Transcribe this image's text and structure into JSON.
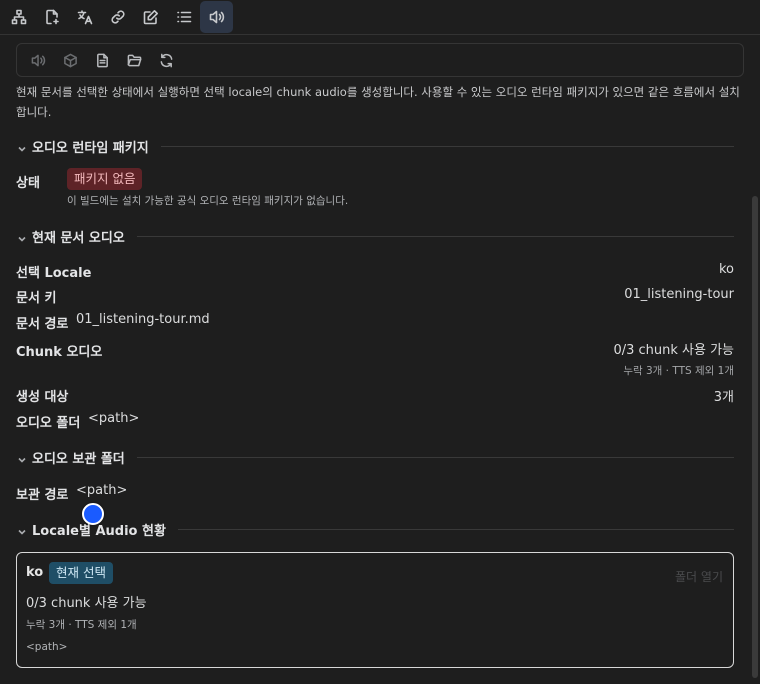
{
  "tabs": [
    {
      "icon": "sitemap-icon"
    },
    {
      "icon": "file-link-icon"
    },
    {
      "icon": "translate-icon"
    },
    {
      "icon": "link-icon"
    },
    {
      "icon": "edit-icon"
    },
    {
      "icon": "list-icon"
    },
    {
      "icon": "speaker-icon",
      "active": true
    }
  ],
  "toolbar": {
    "icons": [
      "speaker-icon",
      "package-icon",
      "document-icon",
      "folder-icon",
      "refresh-icon"
    ]
  },
  "description": "현재 문서를 선택한 상태에서 실행하면 선택 locale의 chunk audio를 생성합니다. 사용할 수 있는 오디오 런타임 패키지가 있으면 같은 흐름에서 설치합니다.",
  "runtime": {
    "heading": "오디오 런타임 패키지",
    "status_label": "상태",
    "status_badge": "패키지 없음",
    "note": "이 빌드에는 설치 가능한 공식 오디오 런타임 패키지가 없습니다."
  },
  "current": {
    "heading": "현재 문서 오디오",
    "locale_label": "선택 Locale",
    "locale_value": "ko",
    "doc_key_label": "문서 키",
    "doc_key_value": "01_listening-tour",
    "doc_path_label": "문서 경로",
    "doc_path_value": "01_listening-tour.md",
    "chunk_label": "Chunk 오디오",
    "chunk_value": "0/3 chunk 사용 가능",
    "chunk_detail": "누락 3개 · TTS 제외 1개",
    "target_label": "생성 대상",
    "target_value": "3개",
    "folder_label": "오디오 폴더",
    "folder_value": "<path>"
  },
  "archive": {
    "heading": "오디오 보관 폴더",
    "path_label": "보관 경로",
    "path_value": "<path>"
  },
  "locales": {
    "heading": "Locale별 Audio 현황",
    "card": {
      "locale": "ko",
      "badge": "현재 선택",
      "open_folder": "폴더 열기",
      "availability": "0/3 chunk 사용 가능",
      "detail": "누락 3개 · TTS 제외 1개",
      "path": "<path>"
    }
  },
  "colors": {
    "accent_tab": "#2d3646",
    "badge_red_bg": "#5e2327",
    "badge_blue_bg": "#1f4e66",
    "cursor": "#1a5bff"
  }
}
